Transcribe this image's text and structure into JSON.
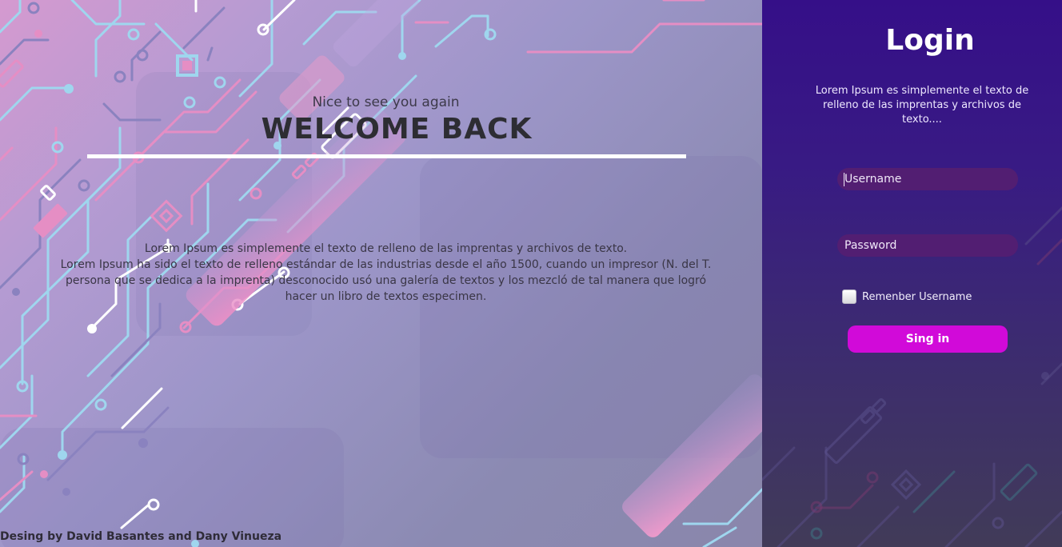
{
  "welcome": {
    "subtitle": "Nice to see you again",
    "title": "WELCOME BACK",
    "paragraph": [
      "Lorem Ipsum es simplemente el texto de relleno de las imprentas y archivos de texto.",
      "Lorem Ipsum ha sido el texto de relleno estándar de las industrias desde el año 1500, cuando un impresor (N. del T.",
      "persona que se dedica a la imprenta) desconocido usó una galería de textos y los mezcló de tal manera que logró",
      "hacer un libro de textos especimen."
    ],
    "credit": "Desing by David Basantes and Dany Vinueza"
  },
  "login": {
    "title": "Login",
    "description": "Lorem Ipsum es simplemente el texto de relleno de las imprentas y archivos de texto....",
    "username_placeholder": "Username",
    "password_placeholder": "Password",
    "remember_label": "Remenber Username",
    "remember_checked": false,
    "signin_label": "Sing in"
  },
  "colors": {
    "signin_button": "#d10ad9",
    "input_background": "#521e72",
    "right_panel_top": "#350f88",
    "right_panel_bottom": "#413b58",
    "rule": "#ffffff"
  },
  "icons": {
    "left_background": "circuit-board-pattern",
    "right_background": "circuit-board-pattern"
  }
}
